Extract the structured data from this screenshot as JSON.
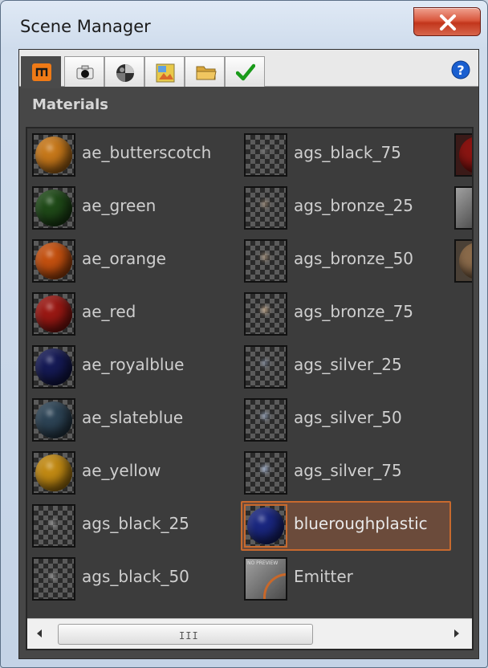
{
  "window": {
    "title": "Scene Manager"
  },
  "tabs": [
    {
      "id": "materials",
      "icon": "materials-icon"
    },
    {
      "id": "camera",
      "icon": "camera-icon"
    },
    {
      "id": "environment",
      "icon": "environment-sphere-icon"
    },
    {
      "id": "renderer",
      "icon": "renderer-icon"
    },
    {
      "id": "folder",
      "icon": "folder-icon"
    },
    {
      "id": "check",
      "icon": "check-icon"
    }
  ],
  "section": {
    "title": "Materials"
  },
  "materials": {
    "column1": [
      {
        "label": "ae_butterscotch",
        "color": "#c7781a"
      },
      {
        "label": "ae_green",
        "color": "#1f4a18"
      },
      {
        "label": "ae_orange",
        "color": "#c4500f"
      },
      {
        "label": "ae_red",
        "color": "#9a1813"
      },
      {
        "label": "ae_royalblue",
        "color": "#151a55"
      },
      {
        "label": "ae_slateblue",
        "color": "#2d4456"
      },
      {
        "label": "ae_yellow",
        "color": "#c28a13"
      },
      {
        "label": "ags_black_25",
        "color": "transparent"
      },
      {
        "label": "ags_black_50",
        "color": "transparent"
      }
    ],
    "column2": [
      {
        "label": "ags_black_75"
      },
      {
        "label": "ags_bronze_25"
      },
      {
        "label": "ags_bronze_50"
      },
      {
        "label": "ags_bronze_75"
      },
      {
        "label": "ags_silver_25"
      },
      {
        "label": "ags_silver_50"
      },
      {
        "label": "ags_silver_75"
      },
      {
        "label": "blueroughplastic",
        "color": "#1a2780",
        "selected": true
      },
      {
        "label": "Emitter",
        "preview_text": "NO PREVIEW"
      }
    ]
  },
  "colors": {
    "selection_border": "#c86a2e",
    "panel_bg": "#474747"
  }
}
